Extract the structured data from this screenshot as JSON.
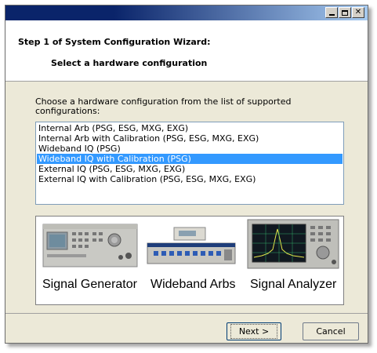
{
  "window": {
    "controls": {
      "minimize": "_",
      "maximize": "□",
      "close": "✕"
    }
  },
  "header": {
    "step_title": "Step 1 of System Configuration Wizard:",
    "step_subtitle": "Select a hardware configuration"
  },
  "main": {
    "prompt": "Choose a hardware configuration from the list of supported configurations:",
    "configurations": [
      {
        "label": "Internal Arb (PSG, ESG, MXG, EXG)",
        "selected": false
      },
      {
        "label": "Internal Arb with Calibration (PSG, ESG, MXG, EXG)",
        "selected": false
      },
      {
        "label": "Wideband IQ (PSG)",
        "selected": false
      },
      {
        "label": "Wideband IQ with Calibration (PSG)",
        "selected": true
      },
      {
        "label": "External IQ (PSG, ESG, MXG, EXG)",
        "selected": false
      },
      {
        "label": "External IQ with Calibration (PSG, ESG, MXG, EXG)",
        "selected": false
      }
    ],
    "instruments": [
      {
        "caption": "Signal Generator"
      },
      {
        "caption": "Wideband Arbs"
      },
      {
        "caption": "Signal Analyzer"
      }
    ]
  },
  "footer": {
    "next_label": "Next >",
    "cancel_label": "Cancel"
  },
  "colors": {
    "selection": "#3399ff",
    "title_gradient_start": "#0a246a",
    "title_gradient_end": "#a6caf0"
  }
}
